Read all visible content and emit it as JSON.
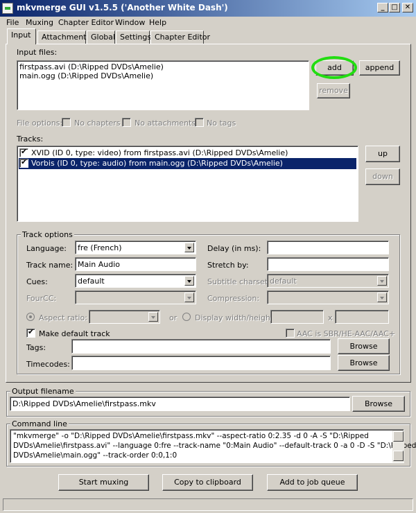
{
  "window": {
    "title": "mkvmerge GUI v1.5.5 ('Another White Dash')",
    "controls": [
      "_",
      "□",
      "✕"
    ]
  },
  "menu": [
    "File",
    "Muxing",
    "Chapter Editor",
    "Window",
    "Help"
  ],
  "tabs": [
    "Input",
    "Attachments",
    "Global",
    "Settings",
    "Chapter Editor"
  ],
  "input_files": {
    "label": "Input files:",
    "items": [
      "firstpass.avi (D:\\Ripped DVDs\\Amelie)",
      "main.ogg (D:\\Ripped DVDs\\Amelie)"
    ],
    "add_label": "add",
    "append_label": "append",
    "remove_label": "remove",
    "highlight_color": "#22dd11"
  },
  "file_options": {
    "label": "File options:",
    "no_chapters": "No chapters",
    "no_attachments": "No attachments",
    "no_tags": "No tags"
  },
  "tracks": {
    "label": "Tracks:",
    "items": [
      {
        "text": "XVID (ID 0, type: video) from firstpass.avi (D:\\Ripped DVDs\\Amelie)",
        "checked": true,
        "selected": false
      },
      {
        "text": "Vorbis (ID 0, type: audio) from main.ogg (D:\\Ripped DVDs\\Amelie)",
        "checked": true,
        "selected": true
      }
    ],
    "up_label": "up",
    "down_label": "down"
  },
  "track_options": {
    "group_label": "Track options",
    "language_label": "Language:",
    "language_value": "fre (French)",
    "track_name_label": "Track name:",
    "track_name_value": "Main Audio",
    "cues_label": "Cues:",
    "cues_value": "default",
    "fourcc_label": "FourCC:",
    "fourcc_value": "",
    "delay_label": "Delay (in ms):",
    "delay_value": "",
    "stretch_label": "Stretch by:",
    "stretch_value": "",
    "subtitle_charset_label": "Subtitle charset:",
    "subtitle_charset_value": "default",
    "compression_label": "Compression:",
    "compression_value": "",
    "aspect_ratio_label": "Aspect ratio:",
    "or_label": "or",
    "display_wh_label": "Display width/height:",
    "x_label": "x",
    "make_default_label": "Make default track",
    "make_default_checked": true,
    "aac_label": "AAC is SBR/HE-AAC/AAC+",
    "tags_label": "Tags:",
    "timecodes_label": "Timecodes:",
    "browse_label": "Browse"
  },
  "output": {
    "group_label": "Output filename",
    "value": "D:\\Ripped DVDs\\Amelie\\firstpass.mkv",
    "browse_label": "Browse"
  },
  "command_line": {
    "group_label": "Command line",
    "lines": [
      "\"mkvmerge\" -o \"D:\\Ripped DVDs\\Amelie\\firstpass.mkv\"  --aspect-ratio 0:2.35 -d 0 -A -S \"D:\\Ripped",
      "DVDs\\Amelie\\firstpass.avi\" --language 0:fre --track-name \"0:Main Audio\" --default-track 0 -a 0 -D -S \"D:\\Ripped",
      "DVDs\\Amelie\\main.ogg\" --track-order 0:0,1:0"
    ]
  },
  "actions": {
    "start_muxing": "Start muxing",
    "copy_clipboard": "Copy to clipboard",
    "add_job_queue": "Add to job queue"
  },
  "colors": {
    "face": "#d4d0c8",
    "selection": "#0a246a",
    "title_start": "#0a246a",
    "title_end": "#a6caf0"
  }
}
